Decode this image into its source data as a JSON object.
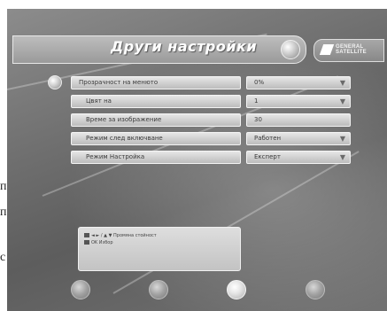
{
  "margin_letters": [
    "п",
    "п",
    "с"
  ],
  "title": "Други настройки",
  "brand": "GENERAL SATELLITE",
  "menu": [
    {
      "label": "Прозрачност на менюто",
      "value": "0%",
      "has_dropdown": true,
      "selected": true
    },
    {
      "label": "Цвят на",
      "value": "1",
      "has_dropdown": true,
      "selected": false
    },
    {
      "label": "Време за изображение",
      "value": "30",
      "has_dropdown": false,
      "selected": false
    },
    {
      "label": "Режим след включване",
      "value": "Работен",
      "has_dropdown": true,
      "selected": false
    },
    {
      "label": "Режим Настройка",
      "value": "Експерт",
      "has_dropdown": true,
      "selected": false
    }
  ],
  "help": {
    "line1": "◄ ► / ▲ ▼ Промяна стойност",
    "line2": "OK Избор"
  },
  "dropdown_arrow": "▼",
  "nav": {
    "count": 4,
    "active_index": 2
  }
}
